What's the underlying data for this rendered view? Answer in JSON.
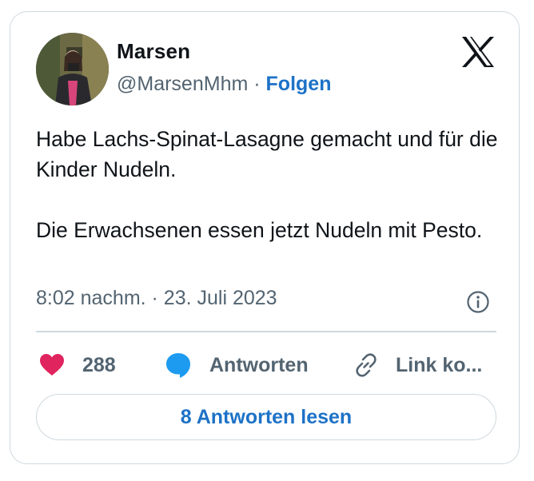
{
  "author": {
    "name": "Marsen",
    "handle": "@MarsenMhm",
    "separator": "·",
    "follow_label": "Folgen"
  },
  "icons": {
    "platform_logo": "x-logo-icon",
    "info": "info-icon",
    "like": "heart-icon",
    "reply": "speech-bubble-icon",
    "copy_link": "link-icon"
  },
  "tweet": {
    "paragraphs": [
      "Habe Lachs-Spinat-Lasagne gemacht und für die Kinder Nudeln.",
      "Die Erwachsenen essen jetzt Nudeln mit Pesto."
    ],
    "timestamp": "8:02 nachm. · 23. Juli 2023"
  },
  "actions": {
    "like_count": "288",
    "reply_label": "Antworten",
    "copy_link_label": "Link ko..."
  },
  "read_replies_label": "8 Antworten lesen",
  "colors": {
    "accent": "#1d72c7",
    "like": "#e0245e",
    "reply": "#1d9bf0",
    "secondary_text": "#536471",
    "border": "#cfd9de"
  }
}
